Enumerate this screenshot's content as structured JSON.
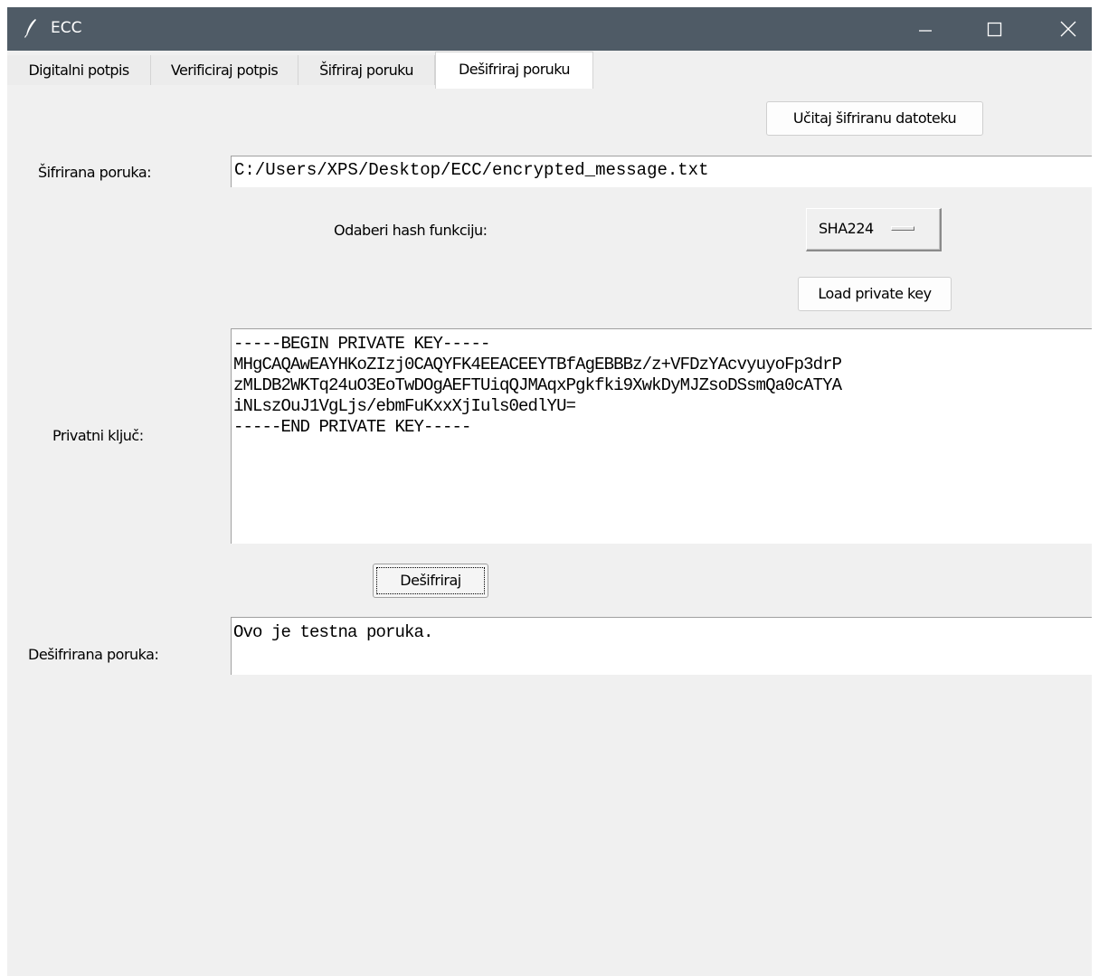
{
  "window": {
    "title": "ECC",
    "minimize_symbol": "—",
    "maximize_symbol": "☐",
    "close_symbol": "✕",
    "app_icon": "feather-icon"
  },
  "tabs": [
    {
      "label": "Digitalni potpis",
      "active": false
    },
    {
      "label": "Verificiraj potpis",
      "active": false
    },
    {
      "label": "Šifriraj poruku",
      "active": false
    },
    {
      "label": "Dešifriraj poruku",
      "active": true
    }
  ],
  "form": {
    "load_encrypted_button": "Učitaj šifriranu datoteku",
    "encrypted_message_label": "Šifrirana poruka:",
    "encrypted_message_value": "C:/Users/XPS/Desktop/ECC/encrypted_message.txt",
    "hash_label": "Odaberi hash funkciju:",
    "hash_selected": "SHA224",
    "load_private_key_button": "Load private key",
    "private_key_label": "Privatni ključ:",
    "private_key_lines": [
      "-----BEGIN PRIVATE KEY-----",
      "MHgCAQAwEAYHKoZIzj0CAQYFK4EEACEEYTBfAgEBBBz/z+VFDzYAcvyuyoFp3drP",
      "zMLDB2WKTq24uO3EoTwDOgAEFTUiqQJMAqxPgkfki9XwkDyMJZsoDSsmQa0cATYA",
      "iNLszOuJ1VgLjs/ebmFuKxxXjIuls0edlYU=",
      "-----END PRIVATE KEY-----"
    ],
    "decrypt_button": "Dešifriraj",
    "decrypted_message_label": "Dešifrirana poruka:",
    "decrypted_message_value": "Ovo je testna poruka."
  },
  "colors": {
    "titlebar": "#4f5b66",
    "window_bg": "#f0f0f0",
    "field_bg": "#ffffff"
  }
}
